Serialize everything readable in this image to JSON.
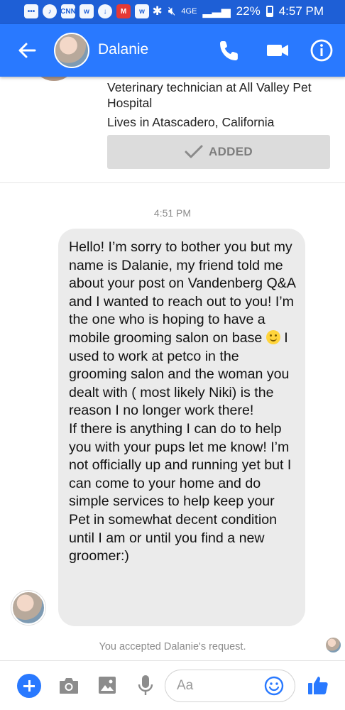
{
  "status_bar": {
    "network_label": "4GE",
    "battery": "22%",
    "time": "4:57 PM",
    "notification_icons": [
      "messenger-icon",
      "music-icon",
      "cnn-icon",
      "w-app-icon",
      "download-icon",
      "m-app-icon",
      "w-app-icon"
    ]
  },
  "header": {
    "name": "Dalanie"
  },
  "profile": {
    "job": "Veterinary technician at All Valley Pet Hospital",
    "location": "Lives in Atascadero, California",
    "added_label": "ADDED"
  },
  "conversation": {
    "time": "4:51 PM",
    "message_part1": "Hello! I’m sorry to bother you but my name is Dalanie, my friend told me about your post on Vandenberg Q&A and I wanted to reach out to you! I’m the one who is hoping to have a mobile grooming salon on base ",
    "message_emoji": "smiling-face-emoji",
    "message_part2": " I used to work at petco in the grooming salon and the woman you dealt with ( most likely Niki) is the reason I no longer work there!\nIf there is anything I can do to help you with your pups let me know! I’m not officially up and running yet but I can come to your home and do simple services to help keep your Pet in somewhat decent condition until I am or until you find a new groomer:)",
    "accepted_note": "You accepted Dalanie's request."
  },
  "composer": {
    "placeholder": "Aa"
  },
  "colors": {
    "header_blue": "#2979ff",
    "status_bar_blue": "#1e5fd6",
    "bubble_gray": "#ebebeb"
  }
}
